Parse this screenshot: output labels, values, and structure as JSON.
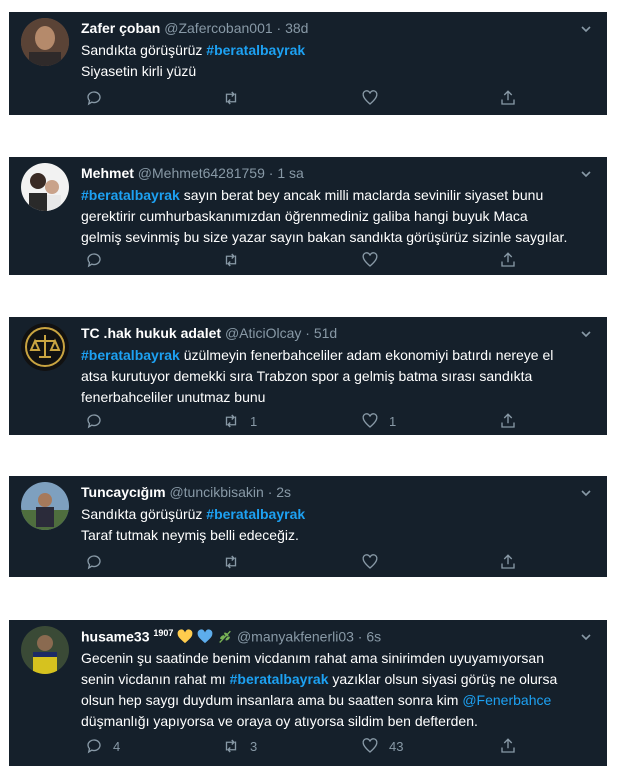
{
  "tweets": [
    {
      "name": "Zafer çoban",
      "handle": "@Zafercoban001",
      "time": "38d",
      "lines": [
        {
          "pre": "Sandıkta görüşürüz ",
          "hashtag": "#beratalbayrak",
          "post": ""
        },
        {
          "text": "Siyasetin kirli yüzü"
        }
      ],
      "reply_count": "",
      "retweet_count": "",
      "like_count": ""
    },
    {
      "name": "Mehmet",
      "handle": "@Mehmet64281759",
      "time": "1 sa",
      "lines": [
        {
          "hashtag": "#beratalbayrak",
          "post": " sayın berat bey ancak milli maclarda sevinilir siyaset bunu"
        },
        {
          "text": "gerektirir cumhurbaskanımızdan öğrenmediniz galiba hangi buyuk Maca"
        },
        {
          "text": "gelmiş sevinmiş bu size yazar sayın bakan sandıkta görüşürüz sizinle saygılar."
        }
      ],
      "reply_count": "",
      "retweet_count": "",
      "like_count": ""
    },
    {
      "name": "TC .hak hukuk adalet",
      "handle": "@AticiOlcay",
      "time": "51d",
      "lines": [
        {
          "hashtag": "#beratalbayrak",
          "post": " üzülmeyin fenerbahceliler adam ekonomiyi batırdı nereye el"
        },
        {
          "text": "atsa kurutuyor demekki sıra Trabzon spor a gelmiş batma sırası sandıkta"
        },
        {
          "text": "fenerbahceliler unutmaz bunu"
        }
      ],
      "reply_count": "",
      "retweet_count": "1",
      "like_count": "1"
    },
    {
      "name": "Tuncaycığım",
      "handle": "@tuncikbisakin",
      "time": "2s",
      "lines": [
        {
          "pre": "Sandıkta görüşürüz ",
          "hashtag": "#beratalbayrak",
          "post": ""
        },
        {
          "text": "Taraf tutmak neymiş belli edeceğiz."
        }
      ],
      "reply_count": "",
      "retweet_count": "",
      "like_count": ""
    },
    {
      "name": "husame33",
      "name_suffix": "1907",
      "handle": "@manyakfenerli03",
      "time": "6s",
      "lines": [
        {
          "text": "Gecenin şu saatinde benim vicdanım rahat ama sinirimden uyuyamıyorsan"
        },
        {
          "pre": "senin vicdanın rahat mı ",
          "hashtag": "#beratalbayrak",
          "post": " yazıklar olsun siyasi görüş ne olursa"
        },
        {
          "pre": "olsun hep saygı duydum insanlara ama bu saatten sonra kim ",
          "mention": "@Fenerbahce"
        },
        {
          "text": "düşmanlığı yapıyorsa ve oraya oy atıyorsa sildim ben defterden."
        }
      ],
      "reply_count": "4",
      "retweet_count": "3",
      "like_count": "43"
    }
  ],
  "separator": "·",
  "icons": {
    "reply": "reply-icon",
    "retweet": "retweet-icon",
    "like": "heart-icon",
    "share": "share-icon",
    "caret": "chevron-down-icon"
  },
  "colors": {
    "card_bg": "#15202b",
    "text": "#ffffff",
    "muted": "#8899a6",
    "link": "#1da1f2"
  }
}
